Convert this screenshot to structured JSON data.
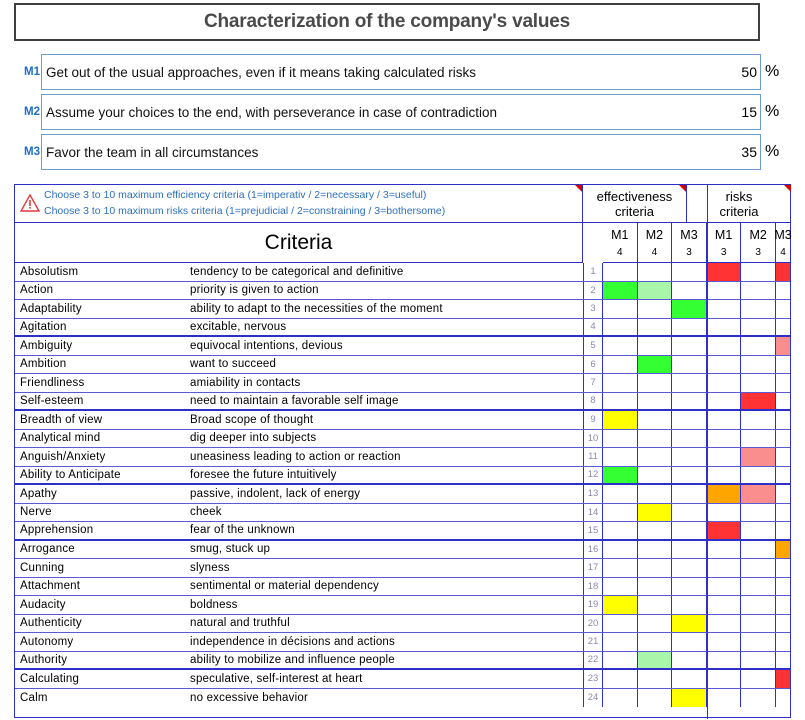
{
  "title": "Characterization of the company's values",
  "colors": {
    "accent_blue": "#2c6fc0",
    "grid_blue": "#2e2ec8",
    "green": "#33FF33",
    "light_green": "#A9F5A9",
    "yellow": "#FFFF00",
    "red": "#FF3333",
    "orange": "#FFA500",
    "salmon": "#FA8E8E"
  },
  "values_block": {
    "percent_symbol": "%",
    "rows": [
      {
        "tag": "M1",
        "text": "Get out of the usual approaches, even if it means taking calculated risks",
        "value": "50",
        "has_comment_flag": true
      },
      {
        "tag": "M2",
        "text": "Assume your choices to the end, with perseverance in case of contradiction",
        "value": "15",
        "has_comment_flag": false
      },
      {
        "tag": "M3",
        "text": "Favor the team in all circumstances",
        "value": "35",
        "has_comment_flag": false
      }
    ]
  },
  "grid": {
    "warning_icon": "warning-triangle-icon",
    "instructions": [
      "Choose 3 to 10 maximum efficiency criteria (1=imperativ / 2=necessary / 3=useful)",
      "Choose 3 to 10 maximum risks criteria (1=prejudicial / 2=constraining / 3=bothersome)"
    ],
    "group_headers": [
      {
        "line1": "effectiveness",
        "line2": "criteria"
      },
      {
        "line1": "risks",
        "line2": "criteria"
      }
    ],
    "criteria_title": "Criteria",
    "measure_columns": [
      {
        "label": "M1",
        "count": "4"
      },
      {
        "label": "M2",
        "count": "4"
      },
      {
        "label": "M3",
        "count": "3"
      },
      {
        "label": "M1",
        "count": "3"
      },
      {
        "label": "M2",
        "count": "3"
      },
      {
        "label": "M3",
        "count": "4"
      }
    ],
    "rows": [
      {
        "n": "1",
        "name": "Absolutism",
        "def": "tendency to be categorical and definitive",
        "cells": [
          null,
          null,
          null,
          "#FF3333",
          null,
          "#FF3333"
        ],
        "group_end": false
      },
      {
        "n": "2",
        "name": "Action",
        "def": "priority is given to action",
        "cells": [
          "#33FF33",
          "#A9F5A9",
          null,
          null,
          null,
          null
        ],
        "group_end": false
      },
      {
        "n": "3",
        "name": "Adaptability",
        "def": "ability to adapt to the necessities of the moment",
        "cells": [
          null,
          null,
          "#33FF33",
          null,
          null,
          null
        ],
        "group_end": false
      },
      {
        "n": "4",
        "name": "Agitation",
        "def": "excitable, nervous",
        "cells": [
          null,
          null,
          null,
          null,
          null,
          null
        ],
        "group_end": true
      },
      {
        "n": "5",
        "name": "Ambiguity",
        "def": "equivocal intentions, devious",
        "cells": [
          null,
          null,
          null,
          null,
          null,
          "#FA8E8E"
        ],
        "group_end": false
      },
      {
        "n": "6",
        "name": "Ambition",
        "def": "want to succeed",
        "cells": [
          null,
          "#33FF33",
          null,
          null,
          null,
          null
        ],
        "group_end": false
      },
      {
        "n": "7",
        "name": "Friendliness",
        "def": "amiability in contacts",
        "cells": [
          null,
          null,
          null,
          null,
          null,
          null
        ],
        "group_end": false
      },
      {
        "n": "8",
        "name": "Self-esteem",
        "def": "need to maintain a favorable self image",
        "cells": [
          null,
          null,
          null,
          null,
          "#FF3333",
          null
        ],
        "group_end": true
      },
      {
        "n": "9",
        "name": "Breadth of view",
        "def": "Broad scope of thought",
        "cells": [
          "#FFFF00",
          null,
          null,
          null,
          null,
          null
        ],
        "group_end": false
      },
      {
        "n": "10",
        "name": "Analytical mind",
        "def": "dig deeper into subjects",
        "cells": [
          null,
          null,
          null,
          null,
          null,
          null
        ],
        "group_end": false
      },
      {
        "n": "11",
        "name": "Anguish/Anxiety",
        "def": "uneasiness leading to action or reaction",
        "cells": [
          null,
          null,
          null,
          null,
          "#FA8E8E",
          null
        ],
        "group_end": false
      },
      {
        "n": "12",
        "name": "Ability to Anticipate",
        "def": "foresee the future intuitively",
        "cells": [
          "#33FF33",
          null,
          null,
          null,
          null,
          null
        ],
        "group_end": true
      },
      {
        "n": "13",
        "name": "Apathy",
        "def": "passive, indolent, lack of energy",
        "cells": [
          null,
          null,
          null,
          "#FFA500",
          "#FA8E8E",
          null
        ],
        "group_end": false
      },
      {
        "n": "14",
        "name": "Nerve",
        "def": "cheek",
        "cells": [
          null,
          "#FFFF00",
          null,
          null,
          null,
          null
        ],
        "group_end": false
      },
      {
        "n": "15",
        "name": "Apprehension",
        "def": "fear of the unknown",
        "cells": [
          null,
          null,
          null,
          "#FF3333",
          null,
          null
        ],
        "group_end": true
      },
      {
        "n": "16",
        "name": "Arrogance",
        "def": "smug, stuck up",
        "cells": [
          null,
          null,
          null,
          null,
          null,
          "#FFA500"
        ],
        "group_end": false
      },
      {
        "n": "17",
        "name": "Cunning",
        "def": "slyness",
        "cells": [
          null,
          null,
          null,
          null,
          null,
          null
        ],
        "group_end": false
      },
      {
        "n": "18",
        "name": "Attachment",
        "def": "sentimental or material dependency",
        "cells": [
          null,
          null,
          null,
          null,
          null,
          null
        ],
        "group_end": false
      },
      {
        "n": "19",
        "name": "Audacity",
        "def": "boldness",
        "cells": [
          "#FFFF00",
          null,
          null,
          null,
          null,
          null
        ],
        "group_end": false
      },
      {
        "n": "20",
        "name": "Authenticity",
        "def": "natural and truthful",
        "cells": [
          null,
          null,
          "#FFFF00",
          null,
          null,
          null
        ],
        "group_end": false
      },
      {
        "n": "21",
        "name": "Autonomy",
        "def": "independence in décisions and  actions",
        "cells": [
          null,
          null,
          null,
          null,
          null,
          null
        ],
        "group_end": false
      },
      {
        "n": "22",
        "name": "Authority",
        "def": "ability to mobilize and influence people",
        "cells": [
          null,
          "#A9F5A9",
          null,
          null,
          null,
          null
        ],
        "group_end": true
      },
      {
        "n": "23",
        "name": "Calculating",
        "def": "speculative, self-interest at heart",
        "cells": [
          null,
          null,
          null,
          null,
          null,
          "#FF3333"
        ],
        "group_end": false
      },
      {
        "n": "24",
        "name": "Calm",
        "def": "no excessive behavior",
        "cells": [
          null,
          null,
          "#FFFF00",
          null,
          null,
          null
        ],
        "group_end": false
      }
    ]
  }
}
